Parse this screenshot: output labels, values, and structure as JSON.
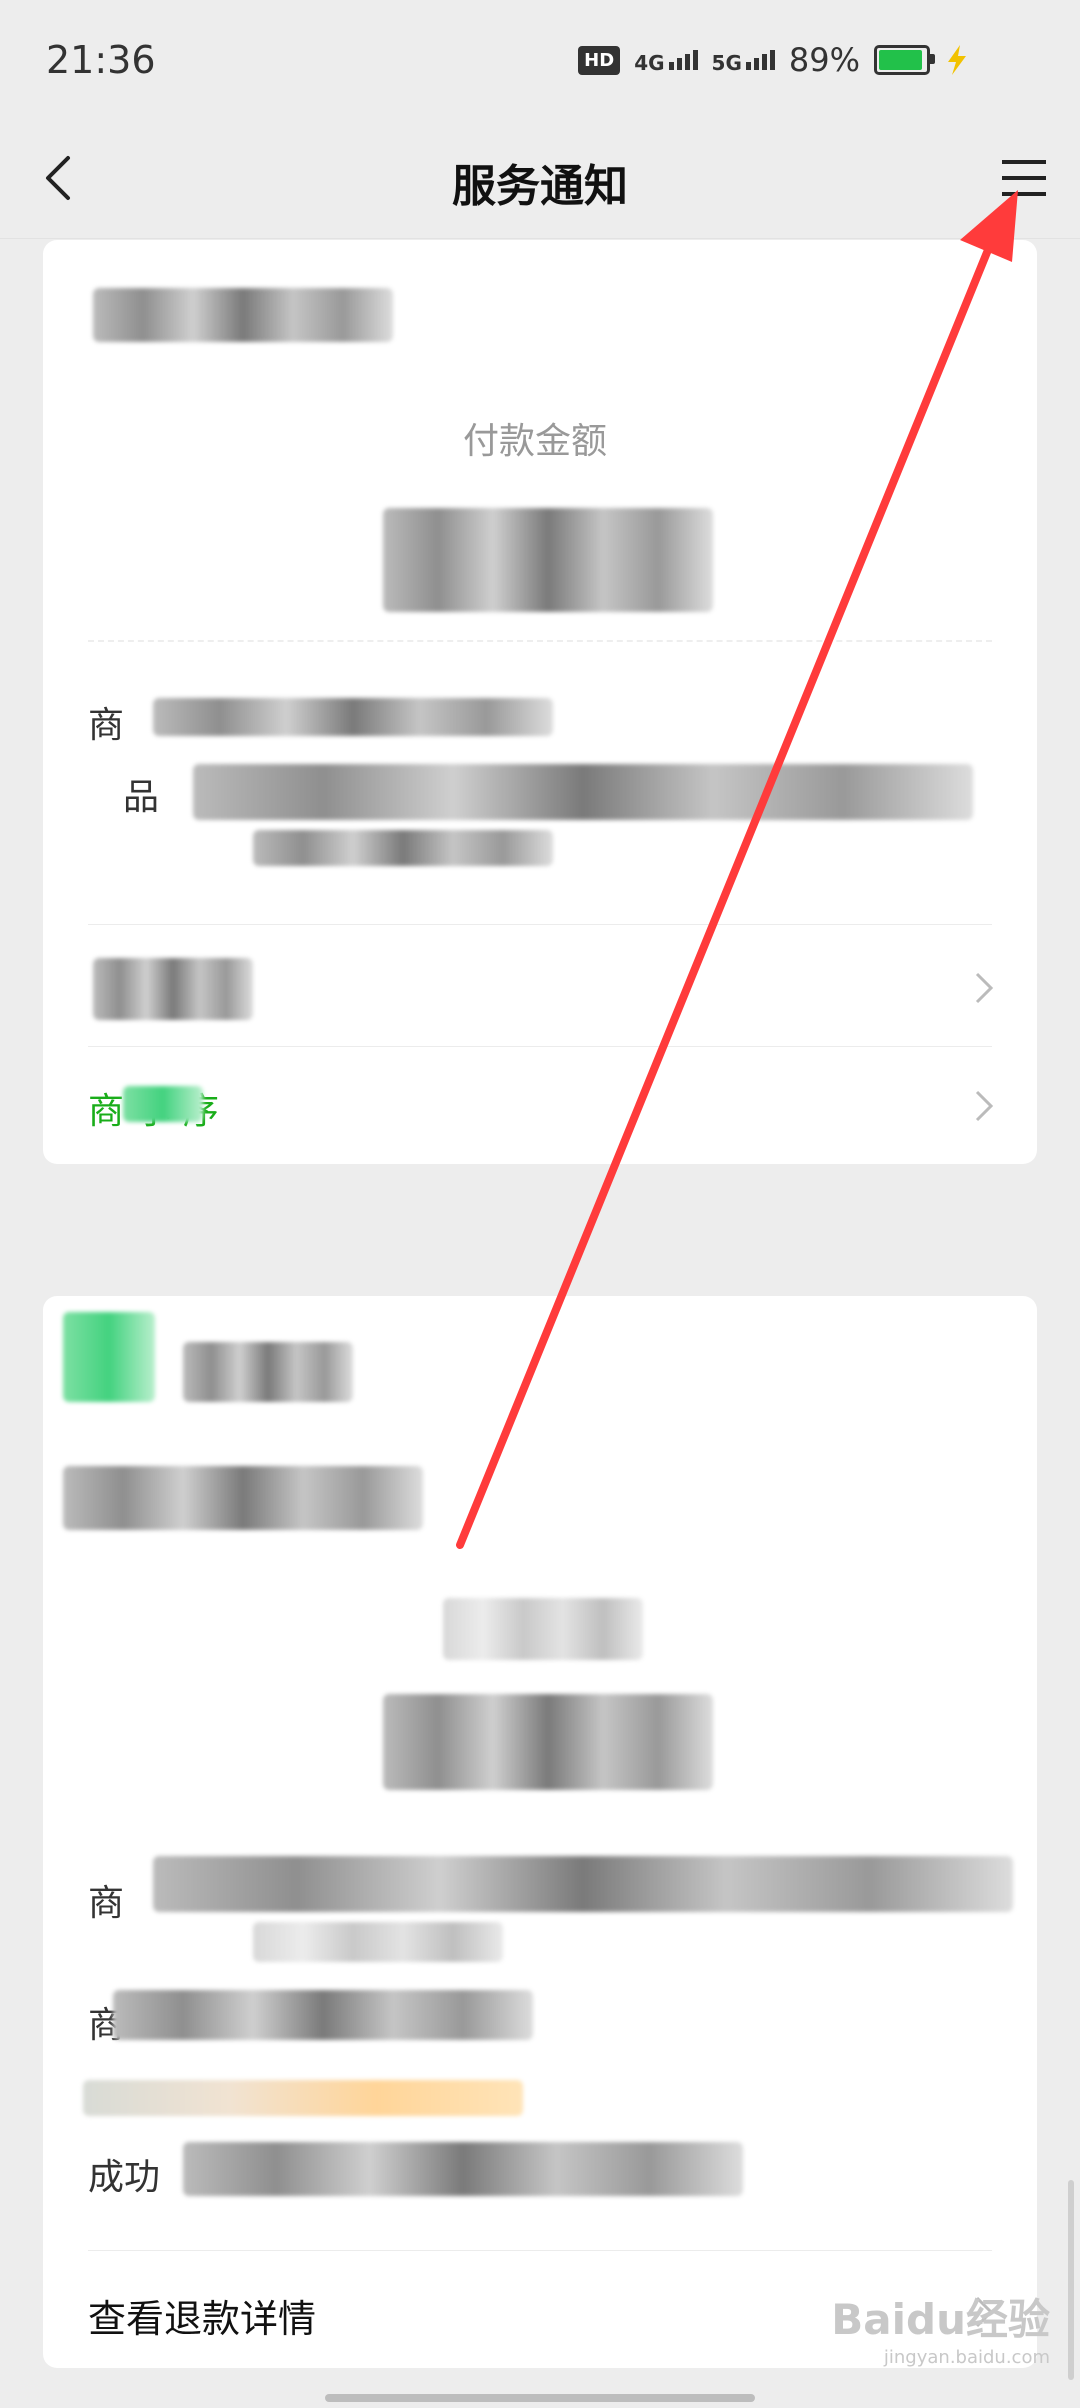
{
  "status_bar": {
    "time": "21:36",
    "hd": "HD",
    "net1": "4G",
    "net2": "5G",
    "battery": "89%",
    "battery_level": 0.89
  },
  "nav": {
    "title": "服务通知",
    "back_icon": "chevron-left-icon",
    "menu_icon": "menu-icon"
  },
  "card1": {
    "amount_label": "付款金额",
    "merchant_label": "商",
    "goods_label": "品",
    "miniprogram_link": "商 小 序"
  },
  "card2": {
    "goods_label": "商",
    "merchant_label": "商",
    "success_label": "成功",
    "refund_link": "查看退款详情"
  },
  "overlay": {
    "arrow_color": "#ff3b3b",
    "watermark": "Baidu经验",
    "watermark_sub": "jingyan.baidu.com"
  }
}
